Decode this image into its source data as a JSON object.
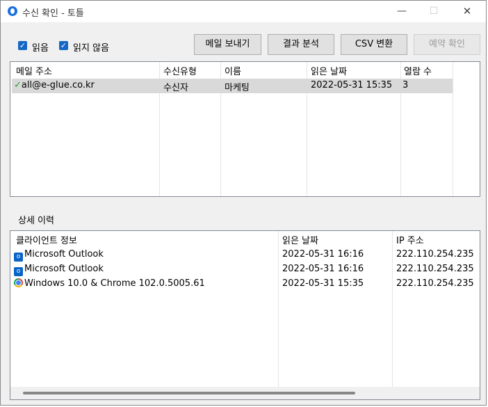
{
  "window": {
    "title": "수신 확인 - 토틀",
    "controls": {
      "minimize": "—",
      "maximize": "☐",
      "close": "✕"
    }
  },
  "filters": {
    "read_label": "읽음",
    "read_checked": true,
    "unread_label": "읽지 않음",
    "unread_checked": true
  },
  "toolbar": {
    "send_mail": "메일 보내기",
    "analyze": "결과 분석",
    "csv": "CSV 변환",
    "reservation": "예약 확인"
  },
  "recipients": {
    "columns": [
      "메일 주소",
      "수신유형",
      "이름",
      "읽은 날짜",
      "열람 수"
    ],
    "rows": [
      {
        "email": "all@e-glue.co.kr",
        "type": "수신자",
        "name": "마케팅",
        "read_date": "2022-05-31 15:35",
        "views": "3"
      }
    ]
  },
  "details": {
    "title": "상세 이력",
    "columns": [
      "클라이언트 정보",
      "읽은 날짜",
      "IP 주소"
    ],
    "rows": [
      {
        "client": "Microsoft Outlook",
        "icon": "outlook-icon",
        "date": "2022-05-31 16:16",
        "ip": "222.110.254.235"
      },
      {
        "client": "Microsoft Outlook",
        "icon": "outlook-icon",
        "date": "2022-05-31 16:16",
        "ip": "222.110.254.235"
      },
      {
        "client": "Windows 10.0 & Chrome 102.0.5005.61",
        "icon": "chrome-icon",
        "date": "2022-05-31 15:35",
        "ip": "222.110.254.235"
      }
    ]
  },
  "colors": {
    "accent": "#1567c4",
    "selection": "#d9d9d9",
    "check": "#2e9a2e"
  }
}
